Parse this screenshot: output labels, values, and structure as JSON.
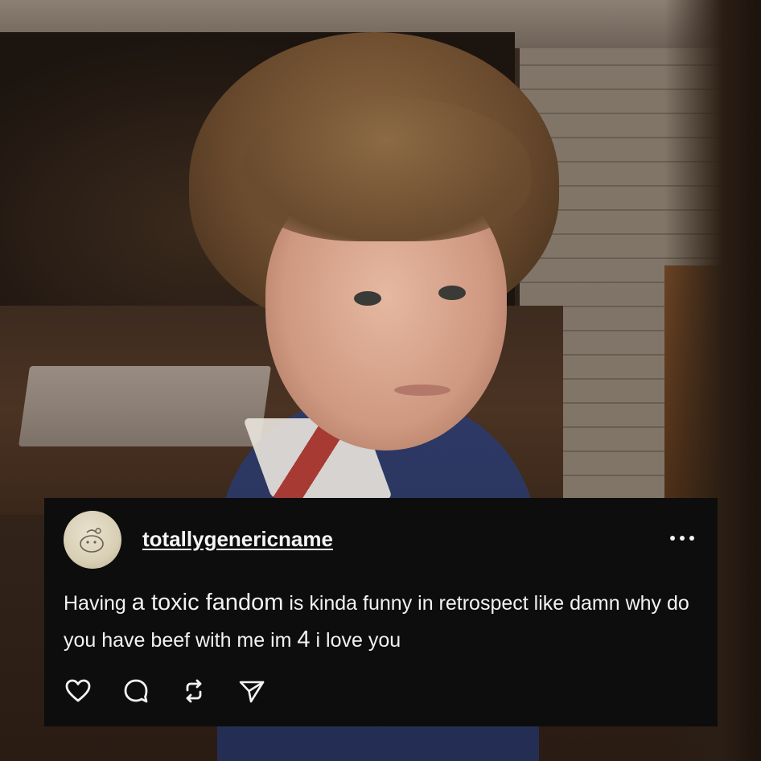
{
  "post": {
    "username": "totallygenericname",
    "text_segments": [
      {
        "text": "Having ",
        "big": false
      },
      {
        "text": "a toxic fandom",
        "big": true
      },
      {
        "text": " is kinda funny in retrospect like damn why do you have beef with me im ",
        "big": false
      },
      {
        "text": "4",
        "big": true
      },
      {
        "text": " i love you",
        "big": false
      }
    ],
    "actions": [
      {
        "name": "like-button",
        "icon": "heart-icon"
      },
      {
        "name": "comment-button",
        "icon": "speech-bubble-icon"
      },
      {
        "name": "repost-button",
        "icon": "repost-icon"
      },
      {
        "name": "share-button",
        "icon": "paper-plane-icon"
      }
    ],
    "more_icon": "more-options-icon"
  },
  "colors": {
    "card_background": "#0d0d0d",
    "text": "#f2f2f2"
  }
}
